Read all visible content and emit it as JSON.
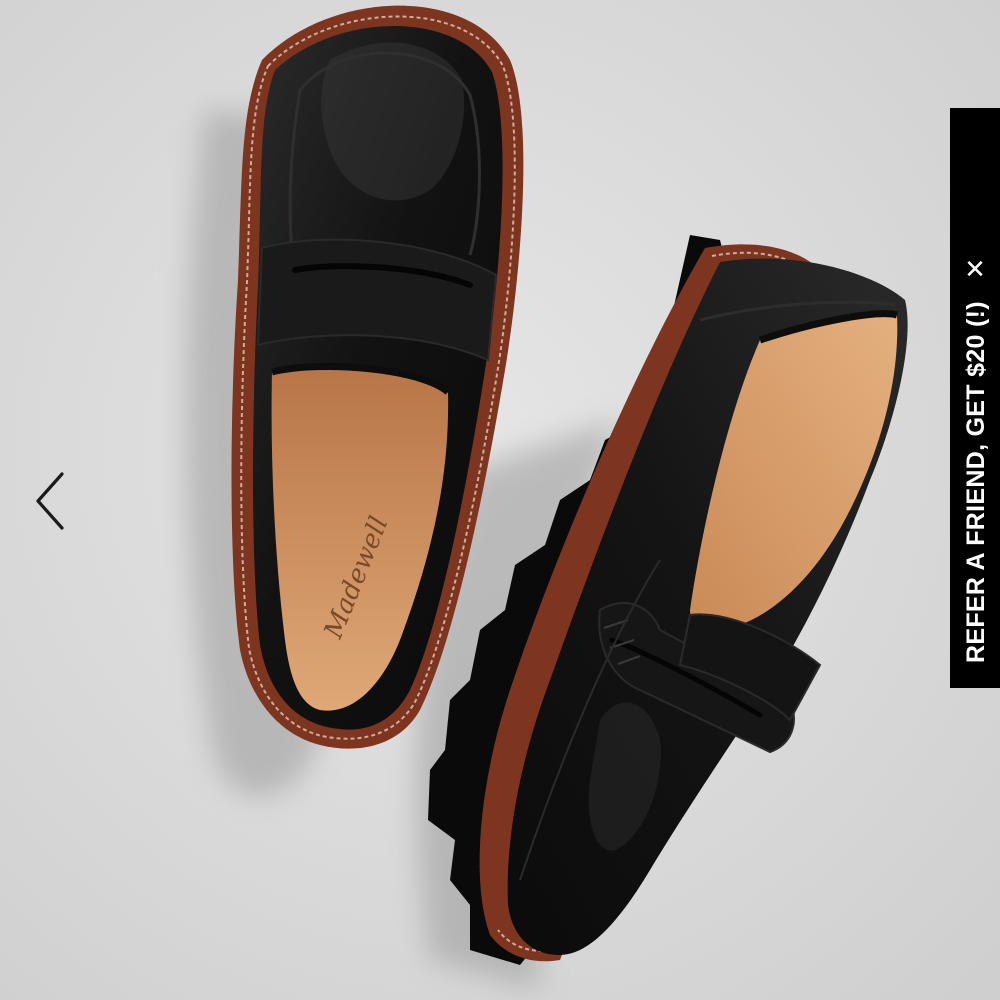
{
  "product_image": {
    "brand_imprint": "Madewell",
    "subject": "black leather lug-sole penny loafers"
  },
  "carousel": {
    "prev_icon": "chevron-left-icon"
  },
  "promo": {
    "label": "REFER A FRIEND, GET $20 (!)",
    "close_icon": "close-icon",
    "close_glyph": "✕",
    "background": "#000000",
    "text_color": "#ffffff"
  },
  "colors": {
    "background": "#dcdcdc",
    "leather": "#141414",
    "sole": "#8a3a22",
    "lining": "#d49a68"
  }
}
